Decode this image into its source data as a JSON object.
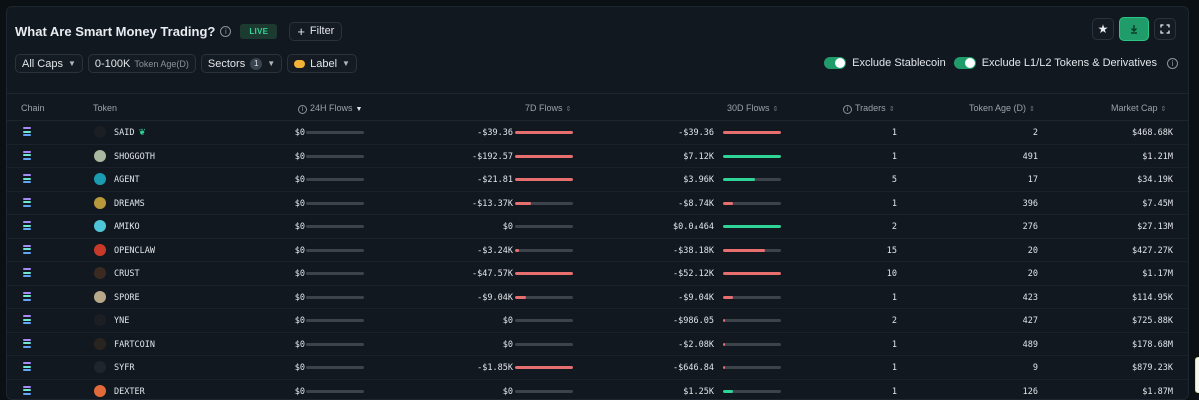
{
  "header": {
    "title": "What Are Smart Money Trading?",
    "info_glyph": "i",
    "live_label": "LIVE",
    "filter_label": "Filter"
  },
  "filters": {
    "caps": "All Caps",
    "token_age_value": "0-100K",
    "token_age_label": "Token Age(D)",
    "sectors_label": "Sectors",
    "sectors_count": "1",
    "label_label": "Label"
  },
  "toggles": {
    "exclude_stablecoin": "Exclude Stablecoin",
    "exclude_l1l2": "Exclude L1/L2 Tokens & Derivatives"
  },
  "columns": {
    "chain": "Chain",
    "token": "Token",
    "flows_24h": "24H Flows",
    "flows_7d": "7D Flows",
    "flows_30d": "30D Flows",
    "traders": "Traders",
    "token_age": "Token Age (D)",
    "market_cap": "Market Cap"
  },
  "colors": {
    "accent_green": "#2fd497",
    "negative_red": "#e86f6f",
    "bar_track": "#3d434a"
  },
  "rows": [
    {
      "token": "SAID",
      "flows_24h": "$0",
      "flows_7d": "-$39.36",
      "flows_30d": "-$39.36",
      "traders": "1",
      "token_age": "2",
      "market_cap": "$468.68K",
      "bar7d": {
        "sign": "neg",
        "level": 1.0
      },
      "bar30d": {
        "sign": "neg",
        "level": 1.0
      },
      "icon_color": "#1b1f24"
    },
    {
      "token": "SHOGGOTH",
      "flows_24h": "$0",
      "flows_7d": "-$192.57",
      "flows_30d": "$7.12K",
      "traders": "1",
      "token_age": "491",
      "market_cap": "$1.21M",
      "bar7d": {
        "sign": "neg",
        "level": 1.0
      },
      "bar30d": {
        "sign": "pos",
        "level": 1.0
      },
      "icon_color": "#a9b8a0"
    },
    {
      "token": "AGENT",
      "flows_24h": "$0",
      "flows_7d": "-$21.81",
      "flows_30d": "$3.96K",
      "traders": "5",
      "token_age": "17",
      "market_cap": "$34.19K",
      "bar7d": {
        "sign": "neg",
        "level": 1.0
      },
      "bar30d": {
        "sign": "pos",
        "level": 0.55
      },
      "icon_color": "#1a9bb0"
    },
    {
      "token": "DREAMS",
      "flows_24h": "$0",
      "flows_7d": "-$13.37K",
      "flows_30d": "-$8.74K",
      "traders": "1",
      "token_age": "396",
      "market_cap": "$7.45M",
      "bar7d": {
        "sign": "neg",
        "level": 0.28
      },
      "bar30d": {
        "sign": "neg",
        "level": 0.17
      },
      "icon_color": "#b99a3a"
    },
    {
      "token": "AMIKO",
      "flows_24h": "$0",
      "flows_7d": "$0",
      "flows_30d": "$0.0₄464",
      "traders": "2",
      "token_age": "276",
      "market_cap": "$27.13M",
      "bar7d": {
        "sign": "none",
        "level": 0
      },
      "bar30d": {
        "sign": "pos",
        "level": 1.0
      },
      "icon_color": "#4fc6d8"
    },
    {
      "token": "OPENCLAW",
      "flows_24h": "$0",
      "flows_7d": "-$3.24K",
      "flows_30d": "-$38.18K",
      "traders": "15",
      "token_age": "20",
      "market_cap": "$427.27K",
      "bar7d": {
        "sign": "neg",
        "level": 0.07
      },
      "bar30d": {
        "sign": "neg",
        "level": 0.73
      },
      "icon_color": "#c73a2a"
    },
    {
      "token": "CRUST",
      "flows_24h": "$0",
      "flows_7d": "-$47.57K",
      "flows_30d": "-$52.12K",
      "traders": "10",
      "token_age": "20",
      "market_cap": "$1.17M",
      "bar7d": {
        "sign": "neg",
        "level": 1.0
      },
      "bar30d": {
        "sign": "neg",
        "level": 1.0
      },
      "icon_color": "#3a2a22"
    },
    {
      "token": "SPORE",
      "flows_24h": "$0",
      "flows_7d": "-$9.04K",
      "flows_30d": "-$9.04K",
      "traders": "1",
      "token_age": "423",
      "market_cap": "$114.95K",
      "bar7d": {
        "sign": "neg",
        "level": 0.19
      },
      "bar30d": {
        "sign": "neg",
        "level": 0.17
      },
      "icon_color": "#b8a88a"
    },
    {
      "token": "YNE",
      "flows_24h": "$0",
      "flows_7d": "$0",
      "flows_30d": "-$986.05",
      "traders": "2",
      "token_age": "427",
      "market_cap": "$725.88K",
      "bar7d": {
        "sign": "none",
        "level": 0
      },
      "bar30d": {
        "sign": "neg",
        "level": 0.02
      },
      "icon_color": "#1b1f24"
    },
    {
      "token": "FARTCOIN",
      "flows_24h": "$0",
      "flows_7d": "$0",
      "flows_30d": "-$2.08K",
      "traders": "1",
      "token_age": "489",
      "market_cap": "$178.68M",
      "bar7d": {
        "sign": "none",
        "level": 0
      },
      "bar30d": {
        "sign": "neg",
        "level": 0.04
      },
      "icon_color": "#2a2420"
    },
    {
      "token": "SYFR",
      "flows_24h": "$0",
      "flows_7d": "-$1.85K",
      "flows_30d": "-$646.84",
      "traders": "1",
      "token_age": "9",
      "market_cap": "$879.23K",
      "bar7d": {
        "sign": "neg",
        "level": 1.0
      },
      "bar30d": {
        "sign": "neg",
        "level": 0.01
      },
      "icon_color": "#20252b"
    },
    {
      "token": "DEXTER",
      "flows_24h": "$0",
      "flows_7d": "$0",
      "flows_30d": "$1.25K",
      "traders": "1",
      "token_age": "126",
      "market_cap": "$1.87M",
      "bar7d": {
        "sign": "none",
        "level": 0
      },
      "bar30d": {
        "sign": "pos",
        "level": 0.17
      },
      "icon_color": "#e26a3a"
    }
  ]
}
